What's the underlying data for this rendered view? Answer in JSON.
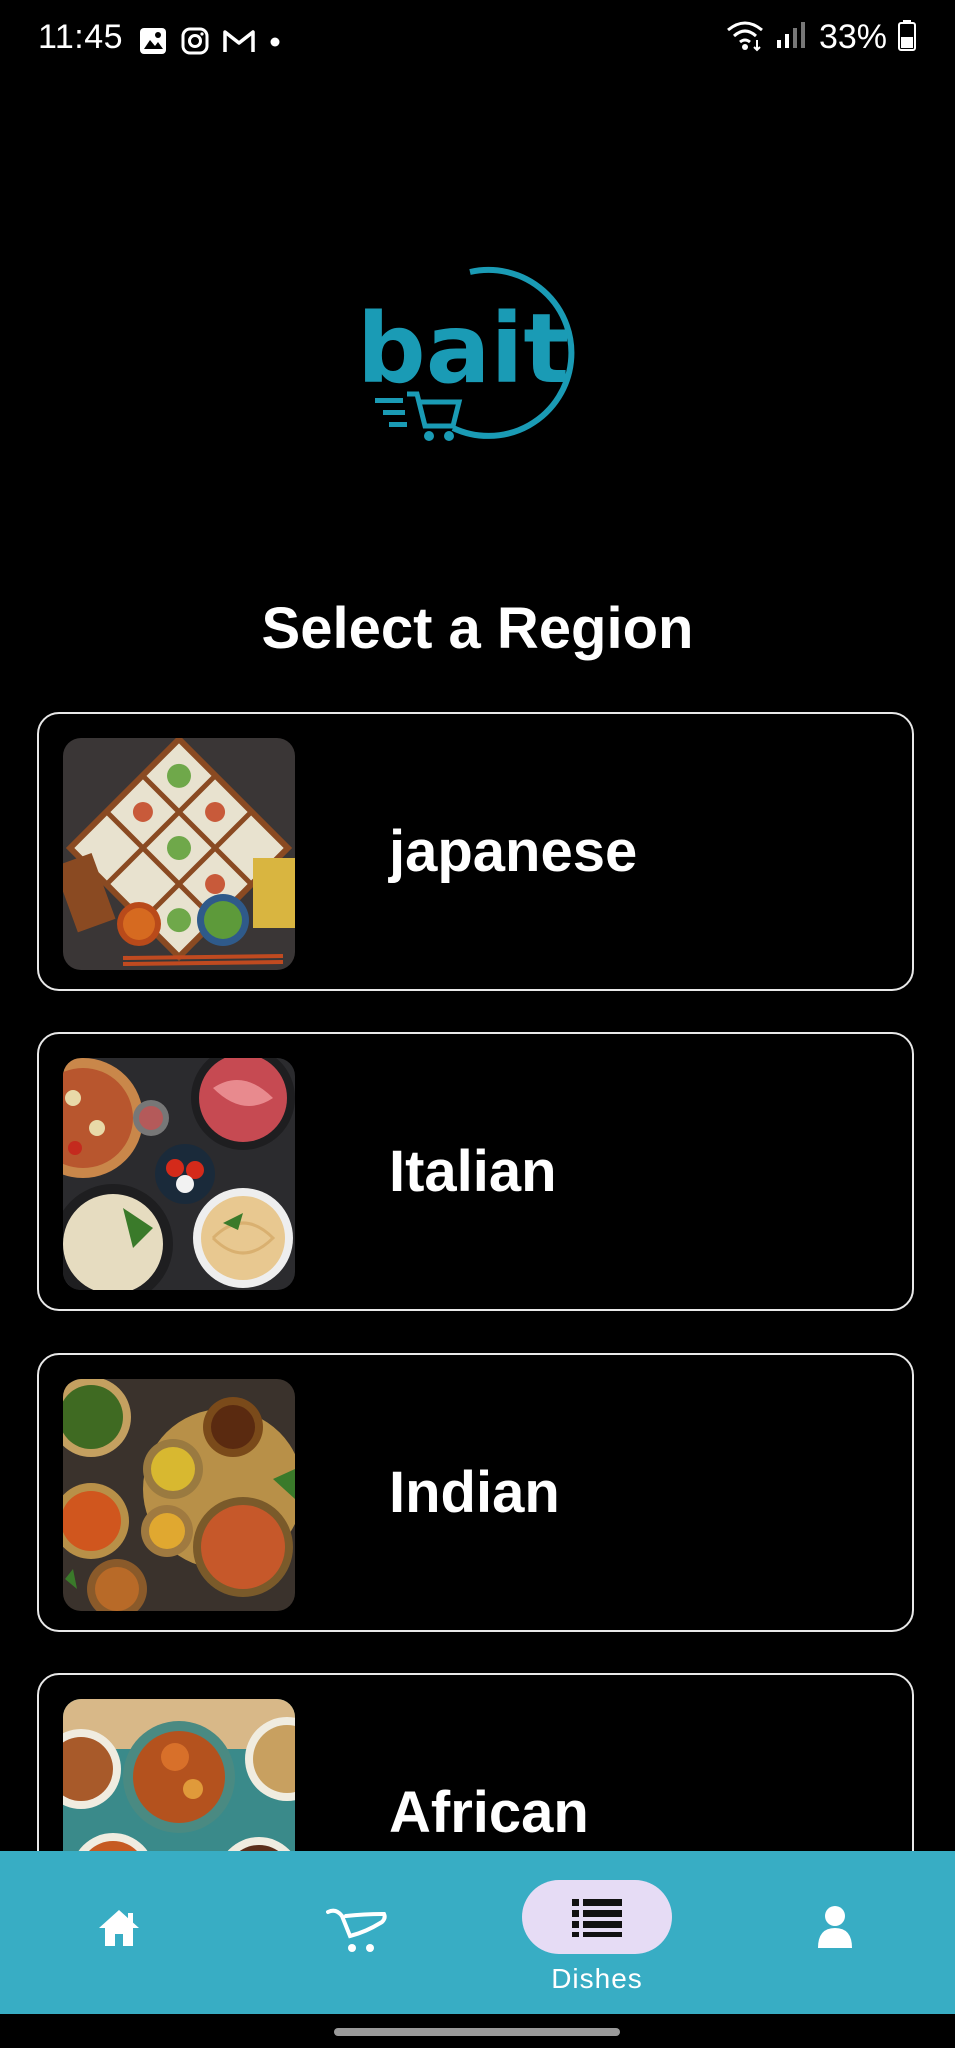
{
  "status_bar": {
    "time": "11:45",
    "battery_percent": "33%",
    "left_icons": [
      "gallery-icon",
      "instagram-icon",
      "gmail-icon",
      "dot-icon"
    ],
    "right_icons": [
      "wifi-icon",
      "signal-icon",
      "battery-icon"
    ]
  },
  "logo": {
    "text": "bait",
    "color": "#1a9bb5"
  },
  "page": {
    "title": "Select a Region"
  },
  "regions": [
    {
      "name": "japanese",
      "image": "japanese-food-image"
    },
    {
      "name": "Italian",
      "image": "italian-food-image"
    },
    {
      "name": "Indian",
      "image": "indian-food-image"
    },
    {
      "name": "African",
      "image": "african-food-image"
    }
  ],
  "bottom_nav": {
    "items": [
      {
        "icon": "home-icon",
        "label": ""
      },
      {
        "icon": "cart-icon",
        "label": ""
      },
      {
        "icon": "list-icon",
        "label": "Dishes",
        "active": true
      },
      {
        "icon": "user-icon",
        "label": ""
      }
    ],
    "background": "#38adc4",
    "active_pill": "#e6dcf5"
  }
}
